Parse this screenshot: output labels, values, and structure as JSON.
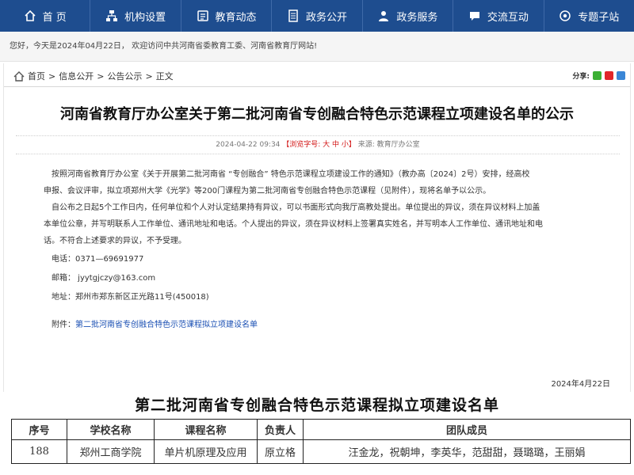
{
  "nav": {
    "items": [
      {
        "label": "首 页",
        "icon": "home-icon"
      },
      {
        "label": "机构设置",
        "icon": "org-chart-icon"
      },
      {
        "label": "教育动态",
        "icon": "news-icon"
      },
      {
        "label": "政务公开",
        "icon": "document-icon"
      },
      {
        "label": "政务服务",
        "icon": "service-icon"
      },
      {
        "label": "交流互动",
        "icon": "chat-icon"
      },
      {
        "label": "专题子站",
        "icon": "topics-icon"
      }
    ]
  },
  "welcome": "您好，今天是2024年04月22日， 欢迎访问中共河南省委教育工委、河南省教育厅网站!",
  "breadcrumb": {
    "items": [
      "首页",
      "信息公开",
      "公告公示",
      "正文"
    ],
    "separator": ">"
  },
  "share": {
    "label": "分享:"
  },
  "article": {
    "title": "河南省教育厅办公室关于第二批河南省专创融合特色示范课程立项建设名单的公示",
    "meta_date": "2024-04-22 09:34",
    "meta_font": "【浏览字号: 大 中 小】",
    "meta_source": "来源: 教育厅办公室",
    "para1_line1": "按照河南省教育厅办公室《关于开展第二批河南省  “专创融合” 特色示范课程立项建设工作的通知》（教办高〔2024〕2号）安排，经高校",
    "para1_line2": "申报、会议评审，拟立项郑州大学《光学》等200门课程为第二批河南省专创融合特色示范课程（见附件），现将名单予以公示。",
    "para2_line1": "自公布之日起5个工作日内，任何单位和个人对认定结果持有异议，可以书面形式向我厅高教处提出。单位提出的异议，须在异议材料上加盖",
    "para2_line2": "本单位公章，并写明联系人工作单位、通讯地址和电话。个人提出的异议，须在异议材料上签署真实姓名，并写明本人工作单位、通讯地址和电",
    "para2_line3": "话。不符合上述要求的异议，不予受理。",
    "phone": "电话：0371—69691977",
    "email": "邮箱：  jyytgjczy@163.com",
    "address": "地址：郑州市郑东新区正光路11号(450018)",
    "attachment_label": "附件：",
    "attachment_link": "第二批河南省专创融合特色示范课程拟立项建设名单",
    "date": "2024年4月22日"
  },
  "doc": {
    "title": "第二批河南省专创融合特色示范课程拟立项建设名单",
    "headers": [
      "序号",
      "学校名称",
      "课程名称",
      "负责人",
      "团队成员"
    ],
    "row": [
      "188",
      "郑州工商学院",
      "单片机原理及应用",
      "原立格",
      "汪金龙，祝朝坤，李英华，范甜甜，聂璐璐，王丽娟"
    ]
  },
  "colors": {
    "nav_bg": "#1e4d8f",
    "link": "#1a4fb3",
    "meta_red": "#d21414"
  }
}
